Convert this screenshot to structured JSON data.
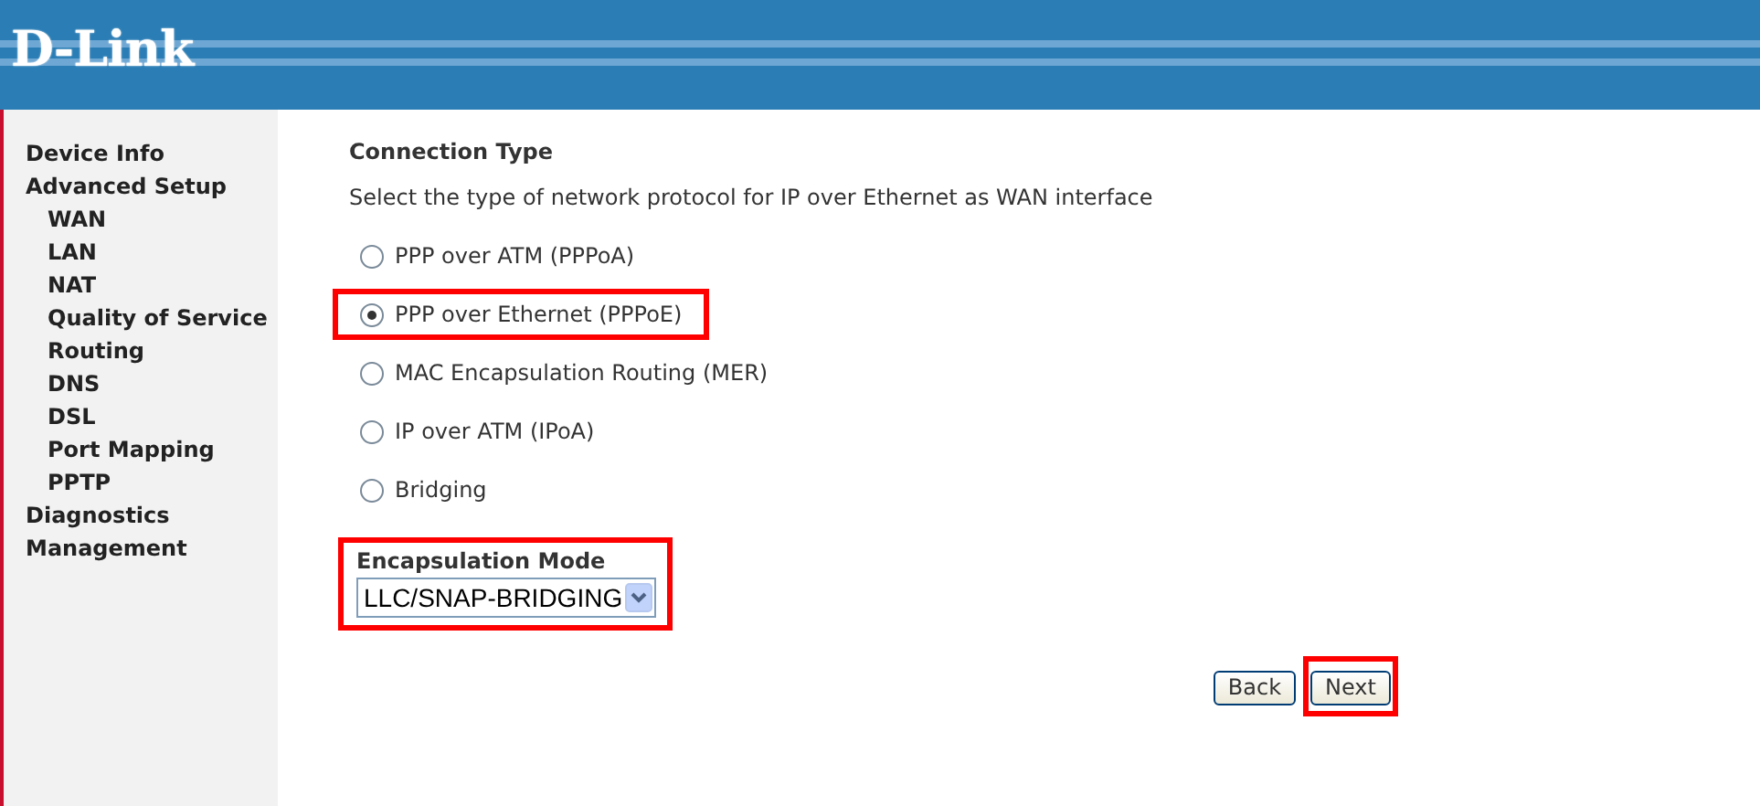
{
  "header": {
    "logo": "D-Link"
  },
  "sidebar": {
    "items": [
      {
        "label": "Device Info"
      },
      {
        "label": "Advanced Setup",
        "children": [
          {
            "label": "WAN"
          },
          {
            "label": "LAN"
          },
          {
            "label": "NAT"
          },
          {
            "label": "Quality of Service"
          },
          {
            "label": "Routing"
          },
          {
            "label": "DNS"
          },
          {
            "label": "DSL"
          },
          {
            "label": "Port Mapping"
          },
          {
            "label": "PPTP"
          }
        ]
      },
      {
        "label": "Diagnostics"
      },
      {
        "label": "Management"
      }
    ]
  },
  "content": {
    "title": "Connection Type",
    "description": "Select the type of network protocol for IP over Ethernet as WAN interface",
    "options": [
      {
        "label": "PPP over ATM (PPPoA)",
        "selected": false,
        "highlighted": false
      },
      {
        "label": "PPP over Ethernet (PPPoE)",
        "selected": true,
        "highlighted": true
      },
      {
        "label": "MAC Encapsulation Routing (MER)",
        "selected": false,
        "highlighted": false
      },
      {
        "label": "IP over ATM (IPoA)",
        "selected": false,
        "highlighted": false
      },
      {
        "label": "Bridging",
        "selected": false,
        "highlighted": false
      }
    ],
    "encapsulation": {
      "label": "Encapsulation Mode",
      "value": "LLC/SNAP-BRIDGING",
      "highlighted": true
    },
    "buttons": [
      {
        "label": "Back",
        "highlighted": false
      },
      {
        "label": "Next",
        "highlighted": true
      }
    ]
  }
}
